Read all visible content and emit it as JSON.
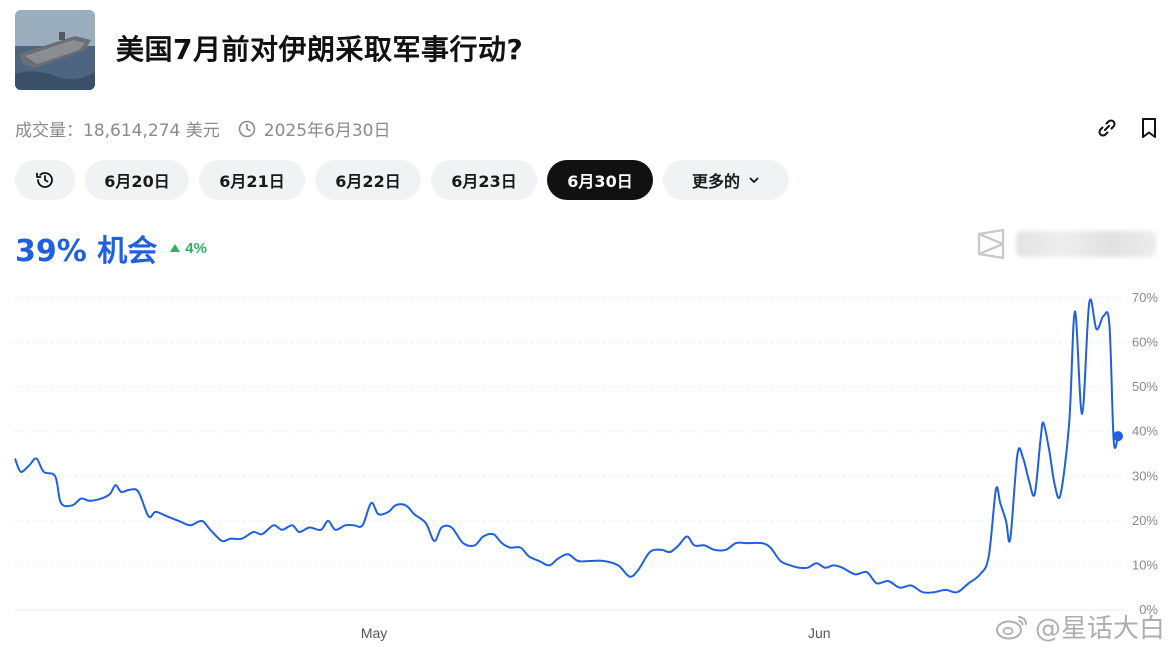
{
  "header": {
    "title": "美国7月前对伊朗采取军事行动?",
    "volume": "成交量：18,614,274 美元",
    "end_date": "2025年6月30日"
  },
  "tabs": [
    {
      "label": "6月20日",
      "active": false
    },
    {
      "label": "6月21日",
      "active": false
    },
    {
      "label": "6月22日",
      "active": false
    },
    {
      "label": "6月23日",
      "active": false
    },
    {
      "label": "6月30日",
      "active": true
    },
    {
      "label": "更多的",
      "active": false
    }
  ],
  "summary": {
    "chance": "39% 机会",
    "change": "4%"
  },
  "watermark": "@星话大白",
  "colors": {
    "line": "#1f5fe0",
    "positive": "#2db35d",
    "grid": "#e6e8eb",
    "active_tab": "#111111"
  },
  "chart_data": {
    "type": "line",
    "title": "",
    "xlabel": "",
    "ylabel": "",
    "ylim": [
      0,
      72
    ],
    "yticks": [
      0,
      10,
      20,
      30,
      40,
      50,
      60,
      70
    ],
    "ytick_labels": [
      "0%",
      "10%",
      "20%",
      "30%",
      "40%",
      "50%",
      "60%",
      "70%"
    ],
    "xticks": [
      {
        "label": "May",
        "x": 25
      },
      {
        "label": "Jun",
        "x": 56
      }
    ],
    "grid": true,
    "series": [
      {
        "values": [
          [
            0,
            34
          ],
          [
            0.4,
            31
          ],
          [
            1,
            32.5
          ],
          [
            1.5,
            34
          ],
          [
            2,
            31
          ],
          [
            2.8,
            30
          ],
          [
            3.2,
            24
          ],
          [
            4,
            23.5
          ],
          [
            4.6,
            25
          ],
          [
            5.2,
            24.5
          ],
          [
            6,
            25
          ],
          [
            6.6,
            26
          ],
          [
            7,
            28
          ],
          [
            7.4,
            26.5
          ],
          [
            8,
            27
          ],
          [
            8.6,
            26.5
          ],
          [
            9.3,
            21
          ],
          [
            9.8,
            22
          ],
          [
            10.6,
            21
          ],
          [
            11.4,
            20
          ],
          [
            12.2,
            19
          ],
          [
            13,
            20
          ],
          [
            13.6,
            18
          ],
          [
            14.4,
            15.5
          ],
          [
            15,
            16
          ],
          [
            15.8,
            16
          ],
          [
            16.6,
            17.5
          ],
          [
            17.2,
            17
          ],
          [
            18,
            19
          ],
          [
            18.6,
            18
          ],
          [
            19.3,
            19
          ],
          [
            19.8,
            17.5
          ],
          [
            20.5,
            18.5
          ],
          [
            21.3,
            18
          ],
          [
            21.8,
            20
          ],
          [
            22.3,
            18
          ],
          [
            23,
            19
          ],
          [
            23.6,
            19
          ],
          [
            24.2,
            19
          ],
          [
            24.8,
            24
          ],
          [
            25.3,
            21.5
          ],
          [
            26,
            22
          ],
          [
            26.5,
            23.5
          ],
          [
            27.2,
            23.5
          ],
          [
            27.8,
            21.5
          ],
          [
            28.6,
            19.5
          ],
          [
            29.2,
            15.5
          ],
          [
            29.7,
            18.5
          ],
          [
            30.4,
            18.5
          ],
          [
            31.2,
            15
          ],
          [
            32,
            14.5
          ],
          [
            32.6,
            16.5
          ],
          [
            33.3,
            17
          ],
          [
            33.9,
            15
          ],
          [
            34.5,
            14
          ],
          [
            35.2,
            14
          ],
          [
            35.8,
            12
          ],
          [
            36.5,
            11
          ],
          [
            37.2,
            10
          ],
          [
            37.8,
            11.5
          ],
          [
            38.5,
            12.5
          ],
          [
            39.2,
            11
          ],
          [
            40,
            11
          ],
          [
            41,
            11
          ],
          [
            42,
            10
          ],
          [
            42.8,
            7.5
          ],
          [
            43.4,
            9
          ],
          [
            44.2,
            13
          ],
          [
            45,
            13.5
          ],
          [
            45.6,
            13
          ],
          [
            46.2,
            14.5
          ],
          [
            46.8,
            16.5
          ],
          [
            47.3,
            14.5
          ],
          [
            48,
            14.5
          ],
          [
            48.7,
            13.5
          ],
          [
            49.5,
            13.5
          ],
          [
            50.2,
            15
          ],
          [
            51,
            15
          ],
          [
            52,
            15
          ],
          [
            52.6,
            14
          ],
          [
            53.3,
            11
          ],
          [
            54,
            10
          ],
          [
            54.6,
            9.5
          ],
          [
            55.2,
            9.5
          ],
          [
            55.8,
            10.5
          ],
          [
            56.4,
            9.5
          ],
          [
            57,
            10
          ],
          [
            57.6,
            9.5
          ],
          [
            58.5,
            8
          ],
          [
            59.3,
            8.5
          ],
          [
            60,
            6
          ],
          [
            60.8,
            6.5
          ],
          [
            61.6,
            5
          ],
          [
            62.4,
            5.5
          ],
          [
            63.2,
            4
          ],
          [
            64,
            4
          ],
          [
            64.8,
            4.5
          ],
          [
            65.6,
            4
          ],
          [
            66.4,
            6
          ],
          [
            67.2,
            8
          ],
          [
            67.8,
            12
          ],
          [
            68.3,
            27
          ],
          [
            68.6,
            24
          ],
          [
            69,
            20
          ],
          [
            69.3,
            16
          ],
          [
            69.8,
            35
          ],
          [
            70.2,
            34
          ],
          [
            70.6,
            29
          ],
          [
            71,
            26
          ],
          [
            71.4,
            38
          ],
          [
            71.6,
            42
          ],
          [
            72,
            36
          ],
          [
            72.4,
            28
          ],
          [
            72.8,
            26
          ],
          [
            73.4,
            42
          ],
          [
            73.8,
            67
          ],
          [
            74.3,
            44
          ],
          [
            74.8,
            69
          ],
          [
            75.3,
            63
          ],
          [
            75.8,
            66
          ],
          [
            76.2,
            64
          ],
          [
            76.5,
            38
          ],
          [
            76.8,
            39
          ]
        ]
      }
    ]
  }
}
